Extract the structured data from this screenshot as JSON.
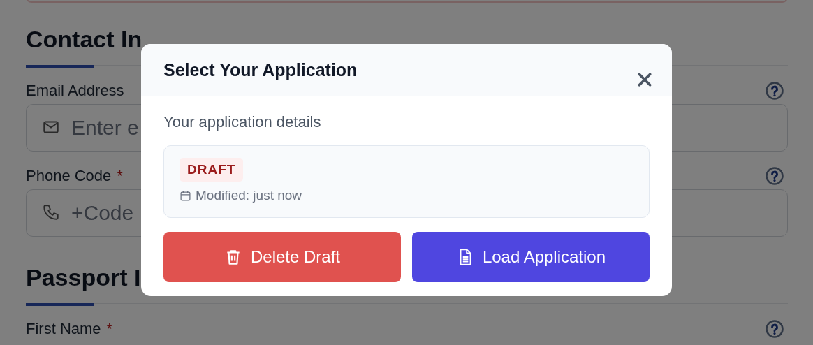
{
  "form": {
    "sections": [
      {
        "title": "Contact In",
        "fields": [
          {
            "label": "Email Address",
            "help": true,
            "kind": "email",
            "placeholder": "Enter e"
          },
          {
            "label": "Phone Code",
            "required_mark": "*",
            "help": true,
            "kind": "phone",
            "placeholder": "+Code"
          }
        ]
      },
      {
        "title": "Passport I",
        "fields": [
          {
            "label": "First Name",
            "required_mark": "*",
            "help": true
          }
        ]
      }
    ]
  },
  "modal": {
    "title": "Select Your Application",
    "subtitle": "Your application details",
    "card": {
      "status": "DRAFT",
      "modified": "Modified: just now"
    },
    "buttons": [
      {
        "label": "Delete Draft",
        "kind": "danger"
      },
      {
        "label": "Load Application",
        "kind": "primary"
      }
    ]
  }
}
